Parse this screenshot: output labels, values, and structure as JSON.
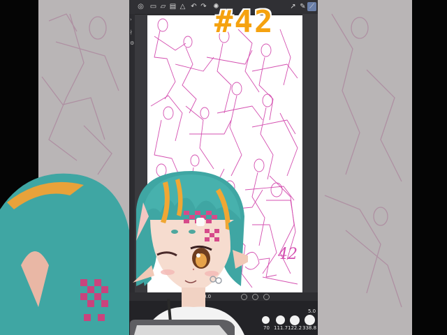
{
  "episode_badge": "#42",
  "canvas": {
    "signature": "42",
    "zoom_label": "0.0"
  },
  "brush_panel": {
    "size_value": "5.0",
    "sizes": [
      "70",
      "111.7",
      "122.2",
      "338.8"
    ]
  },
  "toolbar": {
    "icons": [
      "menu-icon",
      "new-file-icon",
      "open-file-icon",
      "save-icon",
      "warning-icon",
      "undo-icon",
      "redo-icon",
      "transform-icon",
      "select-icon",
      "pen-icon",
      "ruler-icon"
    ]
  },
  "colors": {
    "badge": "#f5a20f",
    "sketch_line": "#d44fb0",
    "hair": "#4fb9b3",
    "hair_highlight": "#f0a734"
  }
}
